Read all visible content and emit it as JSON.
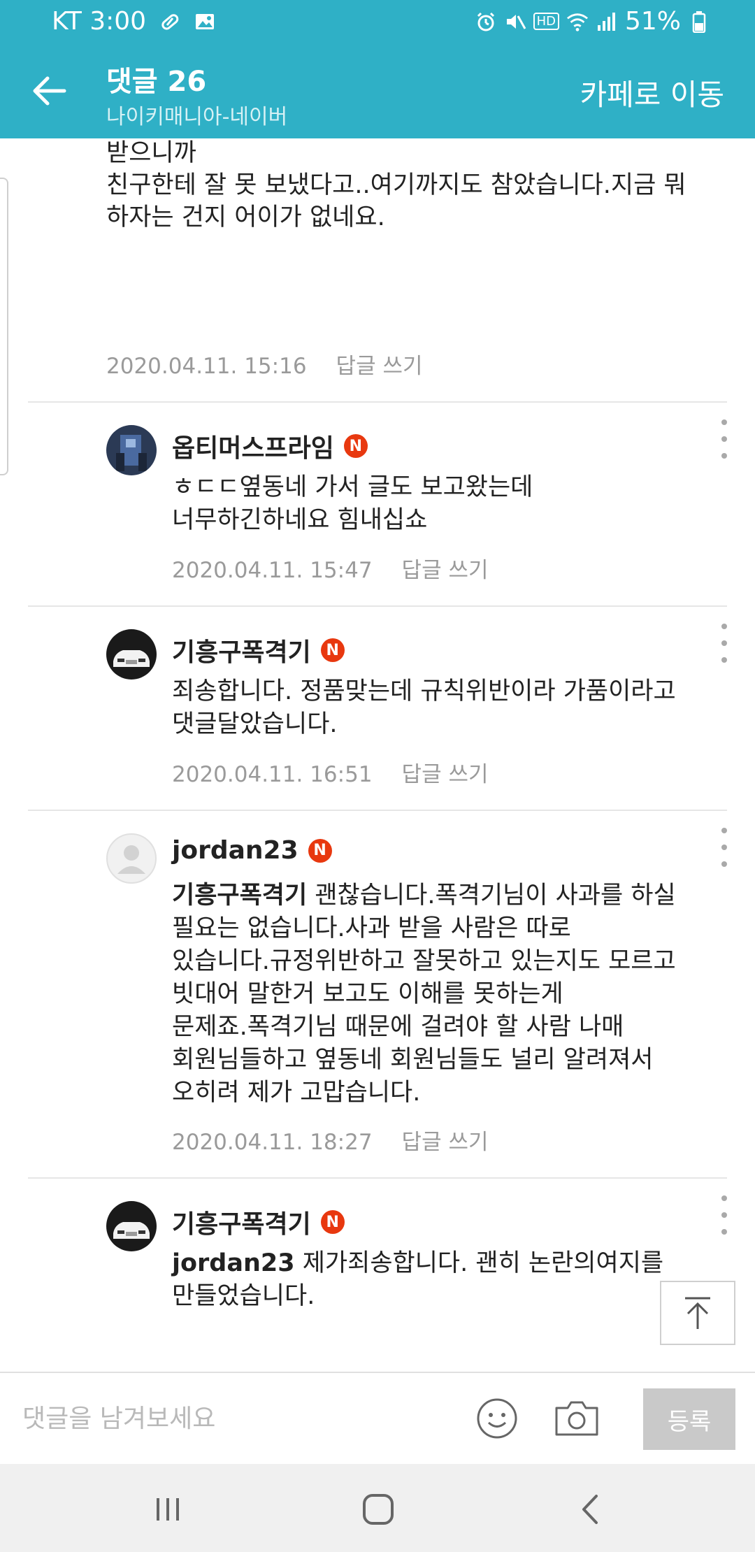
{
  "status_bar": {
    "carrier_time": "KT 3:00",
    "battery": "51%",
    "hd_label": "HD"
  },
  "app_bar": {
    "title": "댓글 26",
    "subtitle": "나이키매니아-네이버",
    "move_to_cafe": "카페로 이동"
  },
  "continued_comment": {
    "text_lines": [
      "받으니까",
      "친구한테 잘 못 보냈다고..여기까지도 참았습니다.지금 뭐",
      "하자는 건지 어이가 없네요."
    ],
    "date": "2020.04.11. 15:16",
    "reply_label": "답글 쓰기"
  },
  "comments": [
    {
      "author": "옵티머스프라임",
      "badge": "N",
      "mention": "",
      "lines": [
        "ㅎㄷㄷ옆동네 가서 글도 보고왔는데",
        "너무하긴하네요 힘내십쇼"
      ],
      "date": "2020.04.11. 15:47",
      "reply_label": "답글 쓰기"
    },
    {
      "author": "기흥구폭격기",
      "badge": "N",
      "mention": "",
      "lines": [
        "죄송합니다. 정품맞는데 규칙위반이라 가품이라고",
        "댓글달았습니다."
      ],
      "date": "2020.04.11. 16:51",
      "reply_label": "답글 쓰기"
    },
    {
      "author": "jordan23",
      "badge": "N",
      "mention": "기흥구폭격기",
      "first_line_rest": " 괜찮습니다.폭격기님이 사과를 하실",
      "lines": [
        "필요는 없습니다.사과 받을 사람은 따로",
        "있습니다.규정위반하고 잘못하고 있는지도 모르고",
        "빗대어 말한거 보고도 이해를 못하는게",
        "문제죠.폭격기님 때문에 걸려야 할 사람 나매",
        "회원님들하고 옆동네 회원님들도 널리 알려져서",
        "오히려 제가 고맙습니다."
      ],
      "date": "2020.04.11. 18:27",
      "reply_label": "답글 쓰기"
    },
    {
      "author": "기흥구폭격기",
      "badge": "N",
      "mention": "jordan23",
      "first_line_rest": " 제가죄송합니다. 괜히 논란의여지를",
      "lines": [
        "만들었습니다."
      ],
      "date": "",
      "reply_label": ""
    }
  ],
  "input_bar": {
    "placeholder": "댓글을 남겨보세요",
    "value": "",
    "submit_label": "등록"
  },
  "icons": {
    "back": "arrow-left-icon",
    "more": "more-vertical-icon",
    "top": "scroll-top-icon",
    "emoji": "smiley-icon",
    "camera": "camera-icon",
    "nav_recent": "recent-apps-icon",
    "nav_home": "home-icon",
    "nav_back": "chevron-left-icon"
  },
  "colors": {
    "header": "#2fb0c6",
    "badge": "#e8380f",
    "meta_text": "#9a9a9a",
    "submit_disabled": "#c9c9c9"
  }
}
